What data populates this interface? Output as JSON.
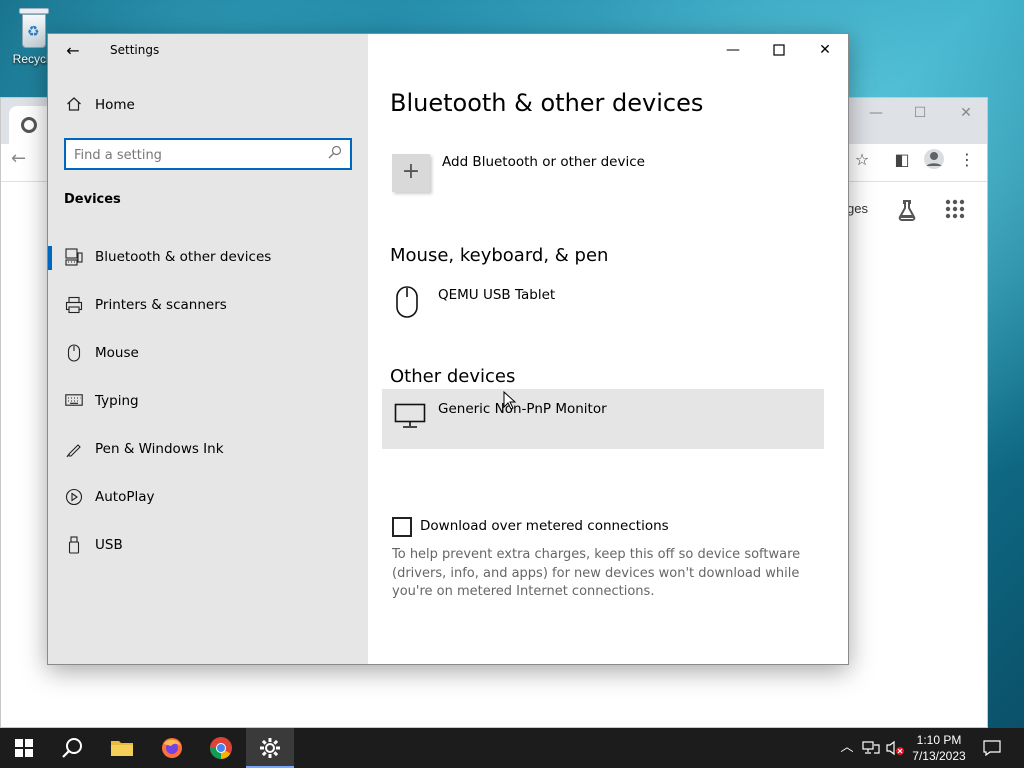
{
  "desktop": {
    "recycle_bin_label": "Recycle"
  },
  "settings": {
    "title": "Settings",
    "sidebar": {
      "home_label": "Home",
      "search_placeholder": "Find a setting",
      "section_label": "Devices",
      "items": [
        {
          "label": "Bluetooth & other devices",
          "icon": "bluetooth-devices-icon",
          "active": true
        },
        {
          "label": "Printers & scanners",
          "icon": "printer-icon",
          "active": false
        },
        {
          "label": "Mouse",
          "icon": "mouse-icon",
          "active": false
        },
        {
          "label": "Typing",
          "icon": "keyboard-icon",
          "active": false
        },
        {
          "label": "Pen & Windows Ink",
          "icon": "pen-icon",
          "active": false
        },
        {
          "label": "AutoPlay",
          "icon": "autoplay-icon",
          "active": false
        },
        {
          "label": "USB",
          "icon": "usb-icon",
          "active": false
        }
      ]
    },
    "main": {
      "page_title": "Bluetooth & other devices",
      "add_device_label": "Add Bluetooth or other device",
      "mouse_section_title": "Mouse, keyboard, & pen",
      "mouse_devices": [
        {
          "name": "QEMU USB Tablet",
          "icon": "mouse-icon"
        }
      ],
      "other_section_title": "Other devices",
      "other_devices": [
        {
          "name": "Generic Non-PnP Monitor",
          "icon": "monitor-icon"
        }
      ],
      "metered_checkbox_label": "Download over metered connections",
      "metered_checked": false,
      "metered_help": "To help prevent extra charges, keep this off so device software (drivers, info, and apps) for new devices won't download while you're on metered Internet connections."
    }
  },
  "chrome_background": {
    "ntp_partial_text": "ges"
  },
  "taskbar": {
    "time": "1:10 PM",
    "date": "7/13/2023"
  },
  "colors": {
    "accent": "#0067c0",
    "sidebar_bg": "#e6e6e6",
    "taskbar_bg": "#1c1c1c"
  }
}
